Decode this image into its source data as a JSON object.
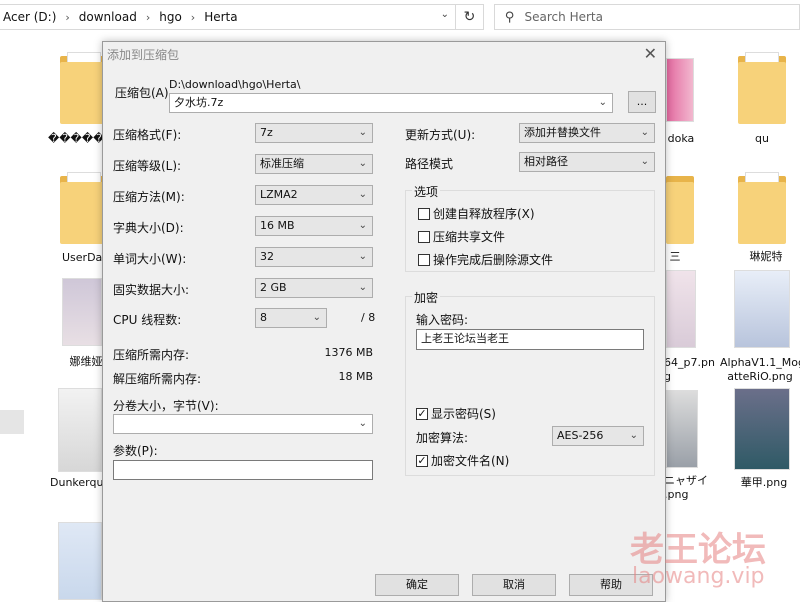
{
  "explorer": {
    "breadcrumb": [
      "Acer (D:)",
      "download",
      "hgo",
      "Herta"
    ],
    "search_placeholder": "Search Herta",
    "items": [
      {
        "label": "������"
      },
      {
        "label": "UserDat"
      },
      {
        "label": "娜维娅"
      },
      {
        "label": "Dunkerque"
      },
      {
        "label": "doka"
      },
      {
        "label": "qu"
      },
      {
        "label": "三"
      },
      {
        "label": "琳妮特"
      },
      {
        "label": "64_p7.pn\ng"
      },
      {
        "label": "AlphaV1.1_Moge\natteRiO.png"
      },
      {
        "label": "ニャザイ\n.png"
      },
      {
        "label": "華甲.png"
      }
    ]
  },
  "dialog": {
    "title": "添加到压缩包",
    "archive_label": "压缩包(A)",
    "archive_path": "D:\\download\\hgo\\Herta\\",
    "archive_name": "夕水坊.7z",
    "browse_label": "...",
    "format_label": "压缩格式(F):",
    "format_value": "7z",
    "level_label": "压缩等级(L):",
    "level_value": "标准压缩",
    "method_label": "压缩方法(M):",
    "method_value": "LZMA2",
    "dict_label": "字典大小(D):",
    "dict_value": "16 MB",
    "word_label": "单词大小(W):",
    "word_value": "32",
    "solid_label": "固实数据大小:",
    "solid_value": "2 GB",
    "cpu_label": "CPU 线程数:",
    "cpu_value": "8",
    "cpu_total": "/ 8",
    "mem_comp_label": "压缩所需内存:",
    "mem_comp_value": "1376 MB",
    "mem_decomp_label": "解压缩所需内存:",
    "mem_decomp_value": "18 MB",
    "volume_label": "分卷大小，字节(V):",
    "volume_value": "",
    "params_label": "参数(P):",
    "params_value": "",
    "update_label": "更新方式(U):",
    "update_value": "添加并替换文件",
    "path_label": "路径模式",
    "path_value": "相对路径",
    "options_title": "选项",
    "opt_sfx": "创建自释放程序(X)",
    "opt_shared": "压缩共享文件",
    "opt_delete": "操作完成后删除源文件",
    "enc_title": "加密",
    "pwd_label": "输入密码:",
    "pwd_value": "上老王论坛当老王",
    "show_pwd": "显示密码(S)",
    "enc_method_label": "加密算法:",
    "enc_method_value": "AES-256",
    "enc_names": "加密文件名(N)",
    "ok": "确定",
    "cancel": "取消",
    "help": "帮助"
  },
  "watermark": {
    "cn": "老王论坛",
    "en": "laowang.vip"
  }
}
